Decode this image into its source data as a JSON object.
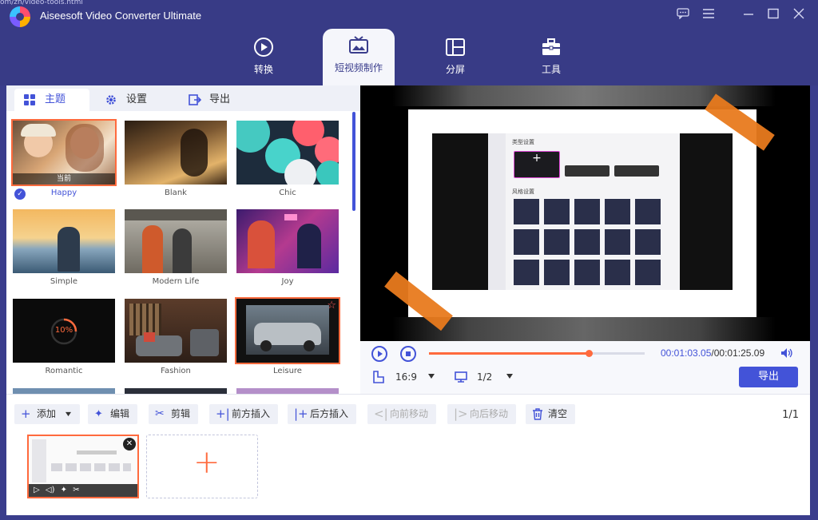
{
  "app": {
    "title": "Aiseesoft Video Converter Ultimate",
    "url_fragment": "om/zh/video-tools.html"
  },
  "nav": {
    "tabs": [
      {
        "label": "转换"
      },
      {
        "label": "短视频制作"
      },
      {
        "label": "分屏"
      },
      {
        "label": "工具"
      }
    ]
  },
  "left": {
    "subtabs": [
      {
        "label": "主题"
      },
      {
        "label": "设置"
      },
      {
        "label": "导出"
      }
    ],
    "themes": [
      {
        "name": "Happy",
        "tag": "当前"
      },
      {
        "name": "Blank"
      },
      {
        "name": "Chic"
      },
      {
        "name": "Simple"
      },
      {
        "name": "Modern Life"
      },
      {
        "name": "Joy"
      },
      {
        "name": "Romantic",
        "badge": "10%"
      },
      {
        "name": "Fashion"
      },
      {
        "name": "Leisure"
      }
    ]
  },
  "preview": {
    "section_labels": {
      "type": "类型设置",
      "style": "风格设置"
    }
  },
  "controls": {
    "time_current": "00:01:03.05",
    "time_total": "/00:01:25.09",
    "progress": 0.74,
    "aspect": "16:9",
    "screen": "1/2",
    "export_label": "导出"
  },
  "timeline": {
    "buttons": {
      "add": "添加",
      "edit": "编辑",
      "trim": "剪辑",
      "insert_before": "前方插入",
      "insert_after": "后方插入",
      "move_forward": "向前移动",
      "move_back": "向后移动",
      "clear": "清空"
    },
    "pager": "1/1"
  },
  "colors": {
    "accent": "#4353d8",
    "orange": "#ff6a3d",
    "chrome": "#383b86"
  }
}
